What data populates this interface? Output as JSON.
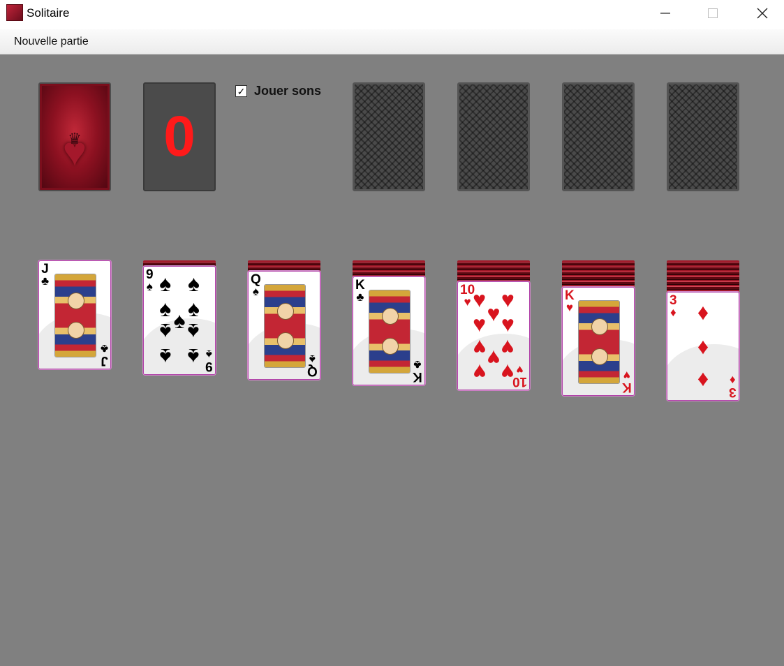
{
  "window": {
    "title": "Solitaire",
    "icon": "solitaire-app-icon",
    "controls": [
      "minimize-icon",
      "maximize-icon",
      "close-icon"
    ]
  },
  "menu": {
    "new_game": "Nouvelle partie"
  },
  "sounds": {
    "label": "Jouer sons",
    "checked": true
  },
  "waste": {
    "count": "0",
    "color": "#ff1a1a"
  },
  "stock": {
    "card_back": "red-heart-crown-back"
  },
  "foundations": [
    {
      "state": "empty"
    },
    {
      "state": "empty"
    },
    {
      "state": "empty"
    },
    {
      "state": "empty"
    }
  ],
  "tableau": [
    {
      "hidden": 0,
      "top": {
        "rank": "J",
        "suit": "♣",
        "color": "black"
      }
    },
    {
      "hidden": 1,
      "top": {
        "rank": "9",
        "suit": "♠",
        "color": "black"
      }
    },
    {
      "hidden": 2,
      "top": {
        "rank": "Q",
        "suit": "♠",
        "color": "black"
      }
    },
    {
      "hidden": 3,
      "top": {
        "rank": "K",
        "suit": "♣",
        "color": "black"
      }
    },
    {
      "hidden": 4,
      "top": {
        "rank": "10",
        "suit": "♥",
        "color": "red"
      }
    },
    {
      "hidden": 5,
      "top": {
        "rank": "K",
        "suit": "♥",
        "color": "red"
      }
    },
    {
      "hidden": 6,
      "top": {
        "rank": "3",
        "suit": "♦",
        "color": "red"
      }
    }
  ],
  "colors": {
    "felt": "#808080",
    "red_suit": "#d8141e",
    "black_suit": "#000000"
  }
}
